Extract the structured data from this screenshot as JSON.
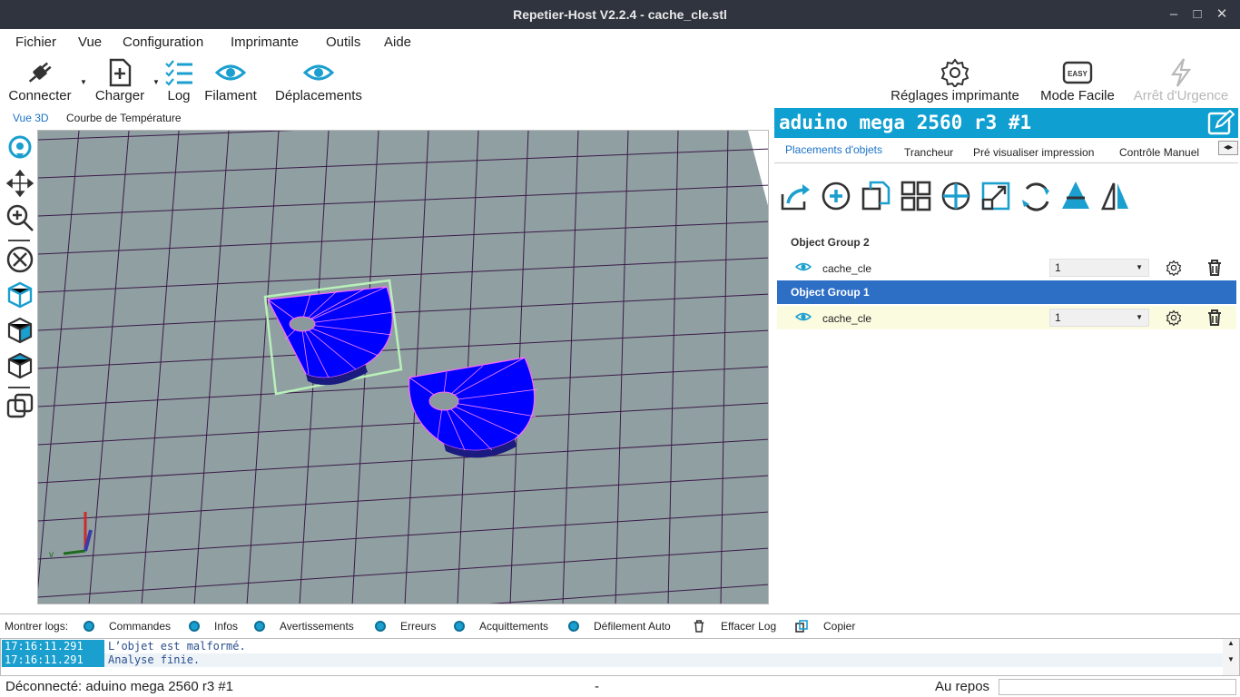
{
  "window": {
    "title": "Repetier-Host V2.2.4 - cache_cle.stl",
    "minimize": "–",
    "maximize": "□",
    "close": "✕"
  },
  "menu": [
    "Fichier",
    "Vue",
    "Configuration",
    "Imprimante",
    "Outils",
    "Aide"
  ],
  "toolbar": {
    "connect": "Connecter",
    "load": "Charger",
    "log": "Log",
    "filament": "Filament",
    "moves": "Déplacements",
    "printer_settings": "Réglages imprimante",
    "easy_mode": "Mode Facile",
    "easy_badge": "EASY",
    "emergency": "Arrêt d'Urgence"
  },
  "view_tabs": [
    "Vue 3D",
    "Courbe de Température"
  ],
  "view_icons": [
    "rotate-icon",
    "move-icon",
    "zoom-icon",
    "fit-icon",
    "iso-view-icon",
    "front-view-icon",
    "top-view-icon",
    "parallel-icon"
  ],
  "printer": {
    "name": "aduino mega 2560 r3 #1"
  },
  "right_tabs": [
    "Placements d'objets",
    "Trancheur",
    "Pré visualiser impression",
    "Contrôle Manuel"
  ],
  "tab_arrows": "◂▸",
  "object_tools": [
    "export-icon",
    "add-object-icon",
    "copy-icon",
    "autoplace-icon",
    "center-icon",
    "scale-icon",
    "rotate-object-icon",
    "cut-icon",
    "mirror-icon"
  ],
  "groups": [
    {
      "name": "Object Group 2",
      "selected": false,
      "objects": [
        {
          "name": "cache_cle",
          "quantity": "1"
        }
      ]
    },
    {
      "name": "Object Group 1",
      "selected": true,
      "objects": [
        {
          "name": "cache_cle",
          "quantity": "1"
        }
      ]
    }
  ],
  "log": {
    "show_label": "Montrer logs:",
    "filters": [
      "Commandes",
      "Infos",
      "Avertissements",
      "Erreurs",
      "Acquittements",
      "Défilement Auto"
    ],
    "clear": "Effacer Log",
    "copy": "Copier",
    "lines": [
      {
        "time": "17:16:11.291",
        "text": "L’objet est malformé."
      },
      {
        "time": "17:16:11.291",
        "text": "Analyse finie."
      }
    ]
  },
  "status": {
    "connection": "Déconnecté: aduino mega 2560 r3 #1",
    "middle": "-",
    "state": "Au repos"
  },
  "colors": {
    "accent": "#0f9fd1",
    "selection": "#2e6fc6",
    "bed": "#909fa1",
    "grid": "#3a1a4a",
    "model": "#0000ff",
    "model_edges": "#ff66ff"
  }
}
